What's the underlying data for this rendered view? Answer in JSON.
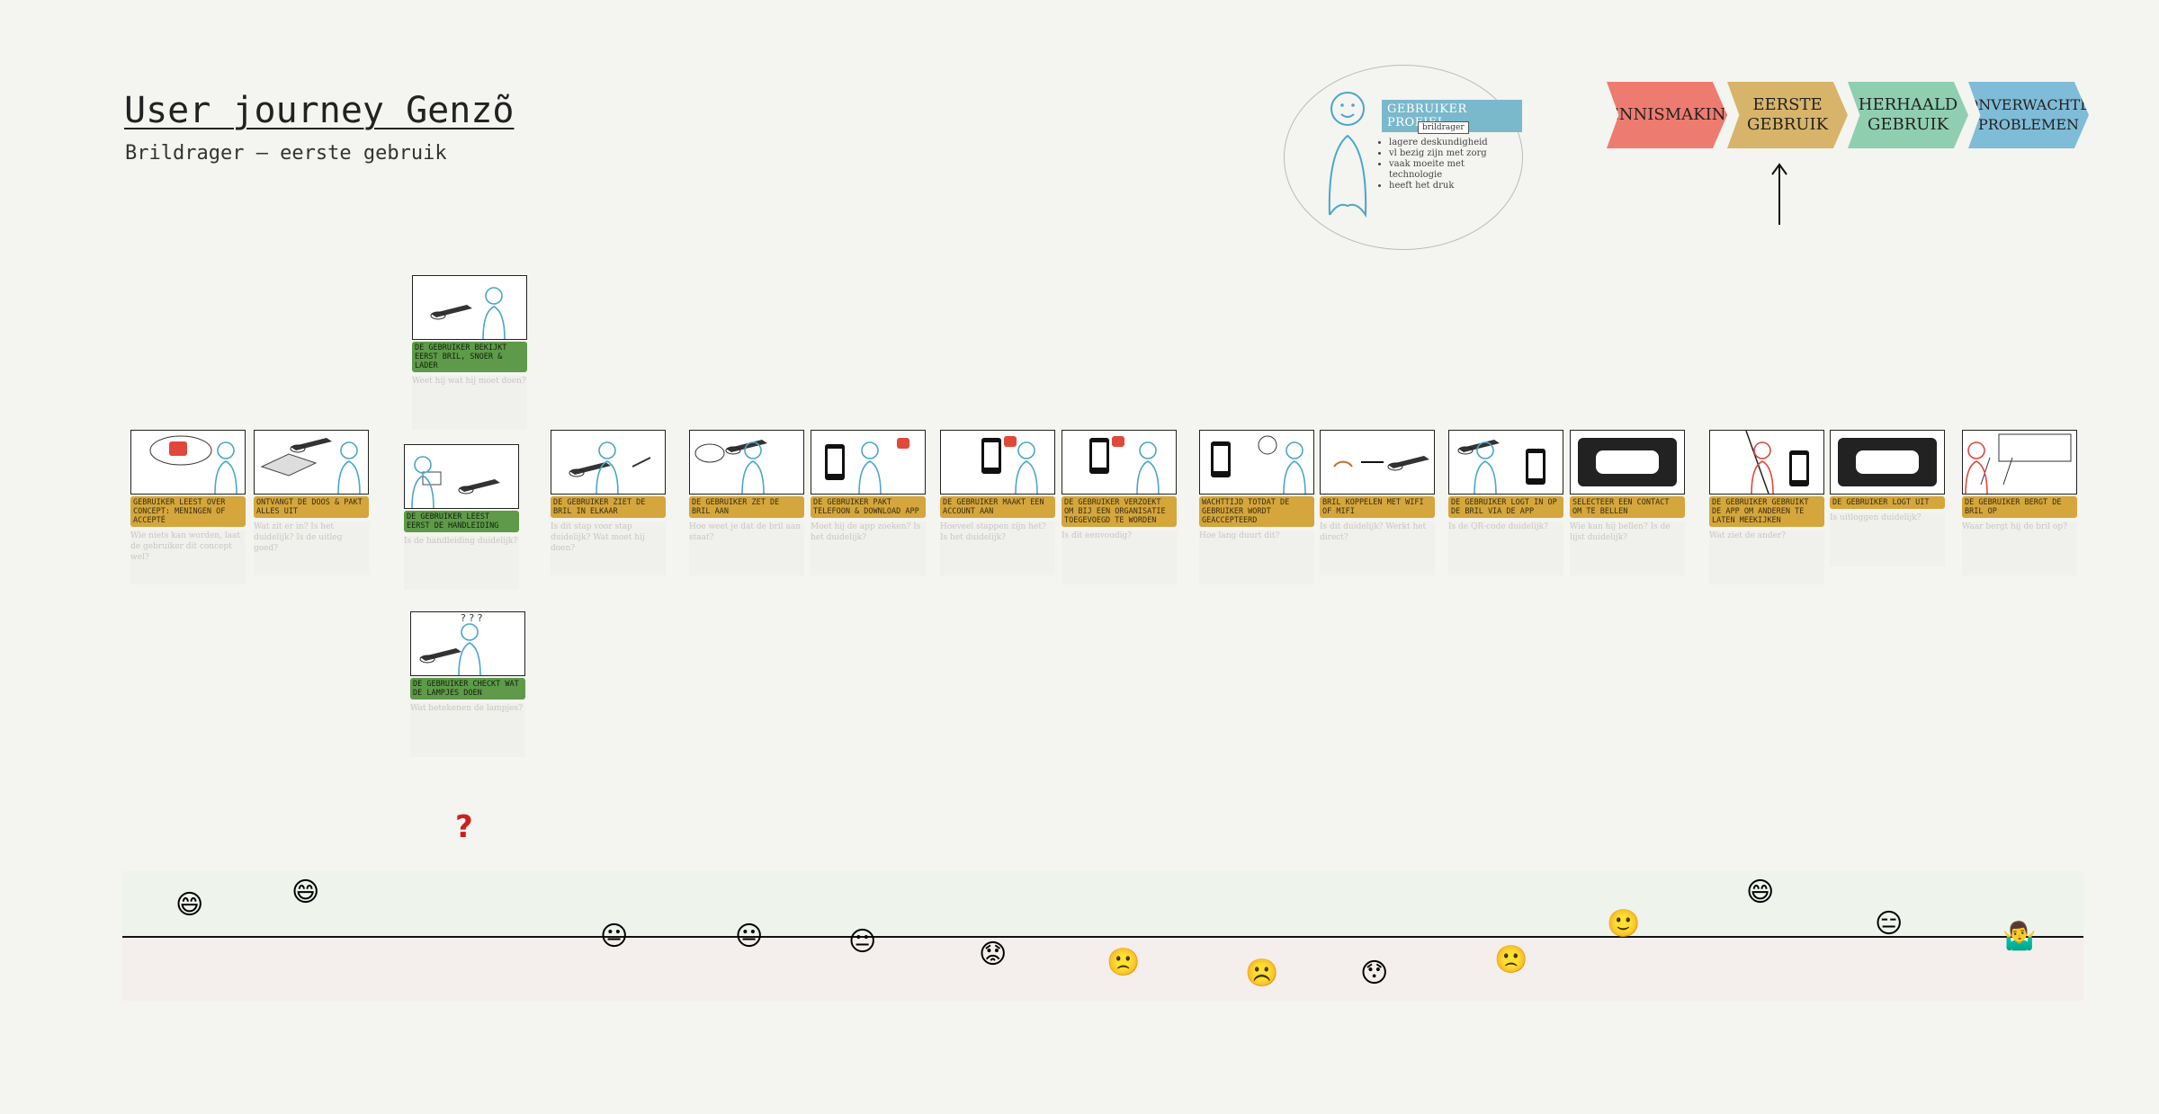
{
  "header": {
    "title": "User journey Genzõ",
    "subtitle": "Brildrager – eerste gebruik"
  },
  "profile": {
    "label": "GEBRUIKER PROFIEL",
    "persona": "brildrager",
    "traits": [
      "lagere deskundigheid",
      "vl bezig zijn met zorg",
      "vaak moeite met technologie",
      "heeft het druk"
    ]
  },
  "phases": [
    {
      "label": "Kennismaking",
      "color": "#ee7b6f"
    },
    {
      "label": "Eerste gebruik",
      "color": "#d7b46a",
      "active": true
    },
    {
      "label": "Herhaald gebruik",
      "color": "#8fcfb0"
    },
    {
      "label": "Onverwachte problemen",
      "color": "#7fbcd8"
    }
  ],
  "steps": [
    {
      "caption": "Gebruiker leest over concept: meningen of accepté",
      "notes": "Wie niets kan worden, laat de gebruiker dit concept wel?"
    },
    {
      "caption": "Ontvangt de doos & pakt alles uit",
      "notes": "Wat zit er in? Is het duidelijk? Is de uitleg goed?"
    },
    {
      "caption": "De gebruiker bekijkt eerst bril, snoer & lader",
      "notes": "Weet hij wat hij moet doen?",
      "branch": true
    },
    {
      "caption": "De gebruiker leest eerst de handleiding",
      "notes": "Is de handleiding duidelijk?",
      "branch": true
    },
    {
      "caption": "De gebruiker ziet de bril in elkaar",
      "notes": "Is dit stap voor stap duidelijk? Wat moet hij doen?"
    },
    {
      "caption": "De gebruiker zet de bril aan",
      "notes": "Hoe weet je dat de bril aan staat?"
    },
    {
      "caption": "De gebruiker pakt telefoon & download app",
      "notes": "Moet hij de app zoeken? Is het duidelijk?"
    },
    {
      "caption": "De gebruiker maakt een account aan",
      "notes": "Hoeveel stappen zijn het? Is het duidelijk?"
    },
    {
      "caption": "De gebruiker verzoekt om bij een organisatie toegevoegd te worden",
      "notes": "Is dit eenvoudig?"
    },
    {
      "caption": "Wachttijd totdat de gebruiker wordt geaccepteerd",
      "notes": "Hoe lang duurt dit?"
    },
    {
      "caption": "Bril koppelen met wifi of mifi",
      "notes": "Is dit duidelijk? Werkt het direct?"
    },
    {
      "caption": "De gebruiker logt in op de bril via de app",
      "notes": "Is de QR-code duidelijk?"
    },
    {
      "caption": "Selecteer een contact om te bellen",
      "notes": "Wie kan hij bellen? Is de lijst duidelijk?"
    },
    {
      "caption": "De gebruiker gebruikt de app om anderen te laten meekijken",
      "notes": "Wat ziet de ander?"
    },
    {
      "caption": "De gebruiker logt uit",
      "notes": "Is uitloggen duidelijk?"
    },
    {
      "caption": "De gebruiker bergt de bril op",
      "notes": "Waar bergt hij de bril op?"
    },
    {
      "caption": "De gebruiker checkt wat de lampjes doen",
      "notes": "Wat betekenen de lampjes?",
      "branch": true
    }
  ],
  "emotions": [
    {
      "emoji": "😄",
      "score": 0.6
    },
    {
      "emoji": "😄",
      "score": 0.85
    },
    {
      "emoji": "😐",
      "score": 0
    },
    {
      "emoji": "😐",
      "score": 0
    },
    {
      "emoji": "😐",
      "score": -0.1
    },
    {
      "emoji": "😟",
      "score": -0.35
    },
    {
      "emoji": "🙁",
      "score": -0.5
    },
    {
      "emoji": "☹️",
      "score": -0.7
    },
    {
      "emoji": "😯",
      "score": -0.7
    },
    {
      "emoji": "🙁",
      "score": -0.45
    },
    {
      "emoji": "🙂",
      "score": 0.25
    },
    {
      "emoji": "😄",
      "score": 0.85
    },
    {
      "emoji": "😑",
      "score": 0.25
    },
    {
      "emoji": "🤷‍♂️",
      "score": 0
    }
  ],
  "question_mark": "?",
  "colors": {
    "gold": "#d4a63c",
    "green": "#5f9a4a",
    "sketch_blue": "#4aa6c8",
    "accent_red": "#e0483c"
  }
}
